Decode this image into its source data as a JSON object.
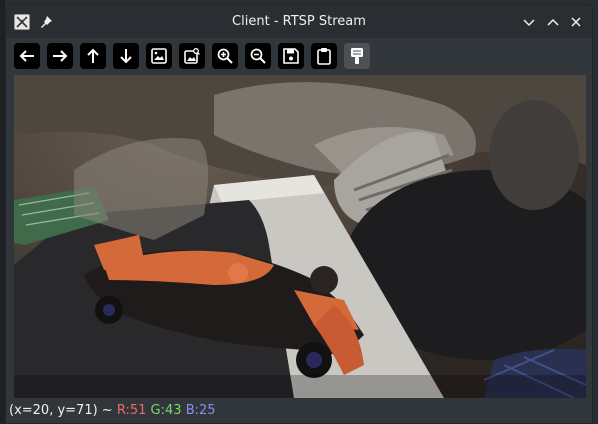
{
  "window": {
    "title": "Client - RTSP Stream",
    "icon": "app-icon",
    "controls": [
      "pin-icon",
      "minimize-icon",
      "maximize-icon",
      "close-icon"
    ]
  },
  "toolbar": {
    "buttons": [
      {
        "name": "arrow-left-icon"
      },
      {
        "name": "arrow-right-icon"
      },
      {
        "name": "arrow-up-icon"
      },
      {
        "name": "arrow-down-icon"
      },
      {
        "name": "image-icon"
      },
      {
        "name": "image-search-icon"
      },
      {
        "name": "zoom-in-icon"
      },
      {
        "name": "zoom-out-icon"
      },
      {
        "name": "save-icon"
      },
      {
        "name": "clipboard-icon"
      },
      {
        "name": "color-picker-icon",
        "active": true
      }
    ]
  },
  "status": {
    "coords": "(x=20, y=71) ~",
    "r": "R:51",
    "g": "G:43",
    "b": "B:25"
  },
  "colors": {
    "r": "#ed6a6a",
    "g": "#7ad76a",
    "b": "#8a8cf2"
  }
}
